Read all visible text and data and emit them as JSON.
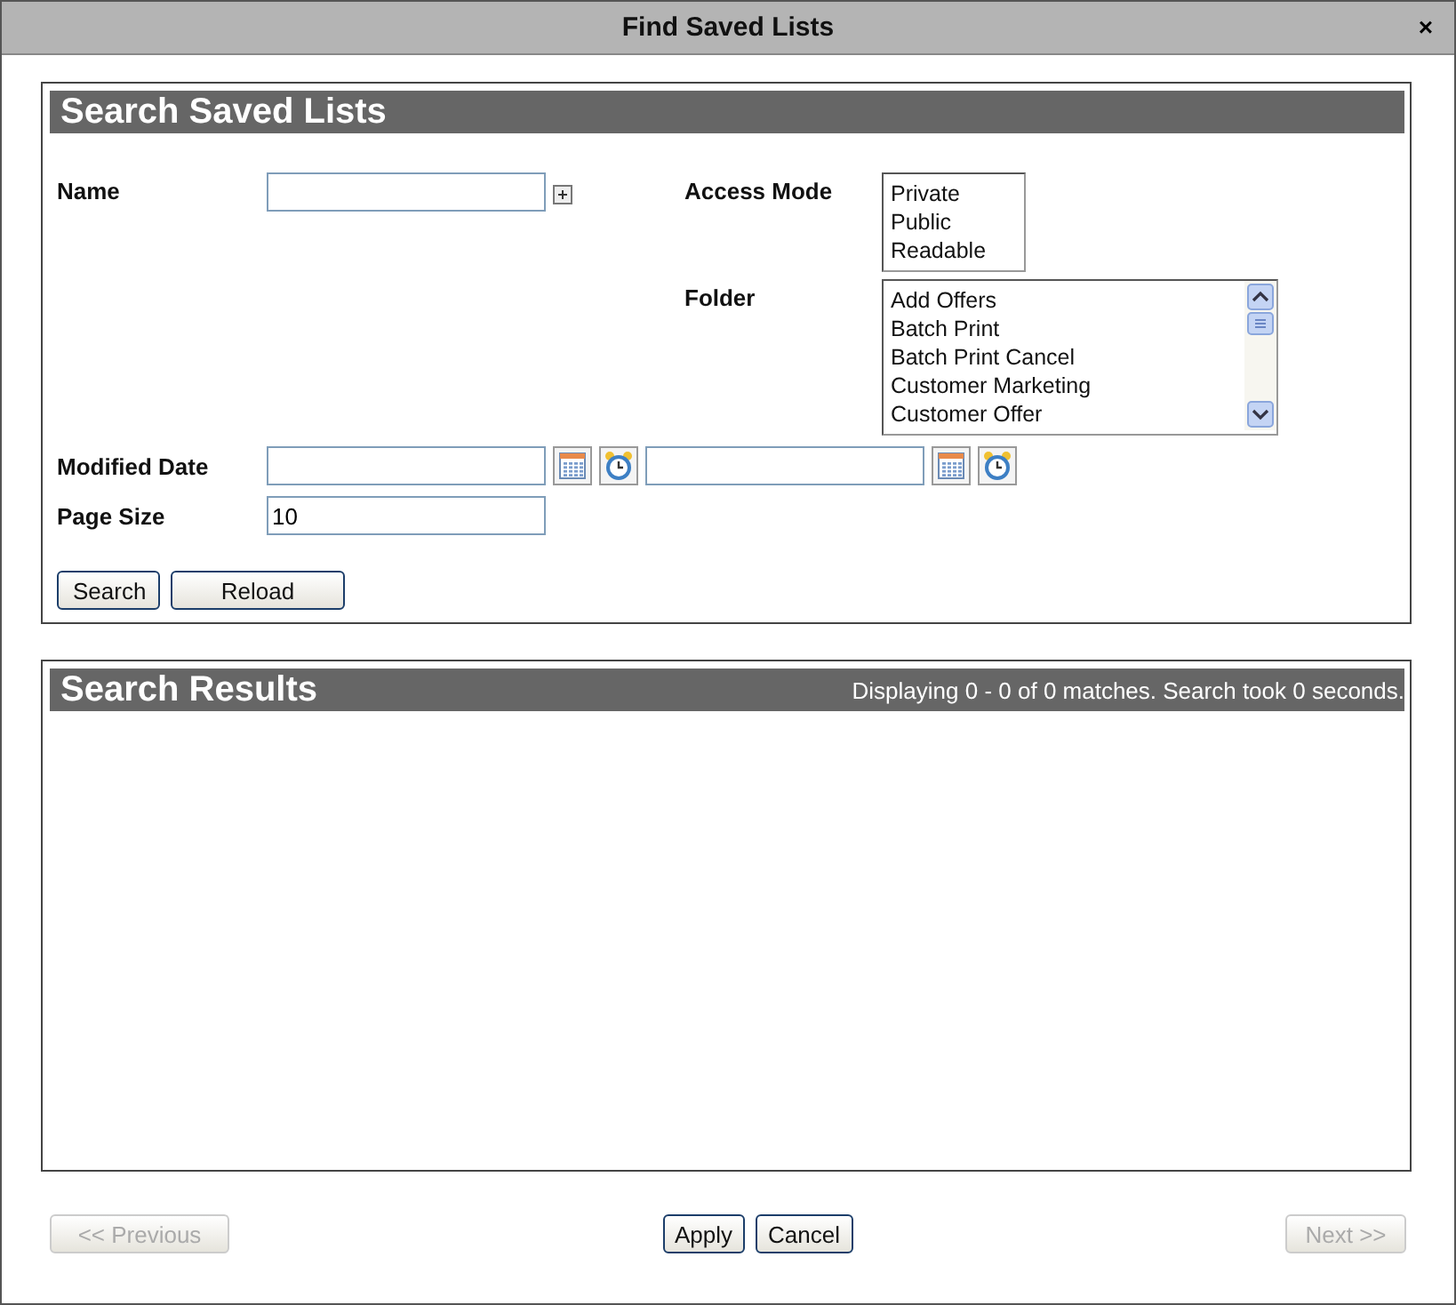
{
  "window": {
    "title": "Find Saved Lists",
    "close": "×"
  },
  "search_panel": {
    "title": "Search Saved Lists",
    "name": {
      "label": "Name"
    },
    "access_mode": {
      "label": "Access Mode",
      "options": [
        "Private",
        "Public",
        "Readable"
      ]
    },
    "folder": {
      "label": "Folder",
      "options": [
        "Add Offers",
        "Batch Print",
        "Batch Print Cancel",
        "Customer Marketing",
        "Customer Offer"
      ]
    },
    "modified_date": {
      "label": "Modified Date"
    },
    "page_size": {
      "label": "Page Size",
      "value": "10"
    },
    "buttons": [
      {
        "label": "Search"
      },
      {
        "label": "Reload"
      }
    ]
  },
  "results_panel": {
    "title": "Search Results",
    "status": "Displaying 0 - 0 of 0 matches. Search took 0 seconds."
  },
  "footer": {
    "previous": {
      "label": "<< Previous",
      "disabled": true
    },
    "actions": [
      {
        "label": "Apply"
      },
      {
        "label": "Cancel"
      }
    ],
    "next": {
      "label": "Next >>",
      "disabled": true
    }
  }
}
